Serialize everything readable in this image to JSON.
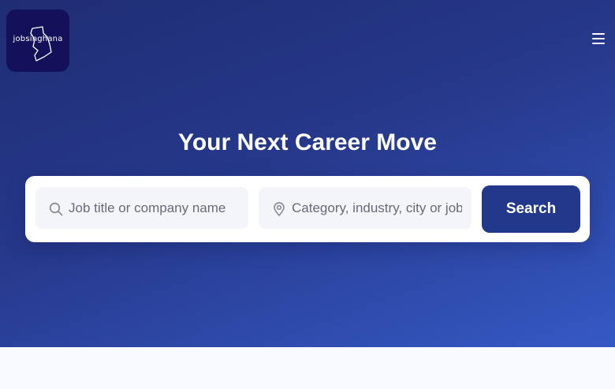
{
  "brand": {
    "logo_text": "jobsinghana"
  },
  "header": {
    "menu_icon": "hamburger-menu-icon"
  },
  "hero": {
    "title": "Your Next Career Move"
  },
  "search": {
    "job_placeholder": "Job title or company name",
    "job_icon": "search-icon",
    "location_placeholder": "Category, industry, city or job type",
    "location_icon": "location-pin-icon",
    "button_label": "Search"
  },
  "colors": {
    "hero_gradient_start": "#1f2d74",
    "hero_gradient_end": "#3559c4",
    "logo_bg": "#14105a",
    "button_bg": "#22388b"
  }
}
